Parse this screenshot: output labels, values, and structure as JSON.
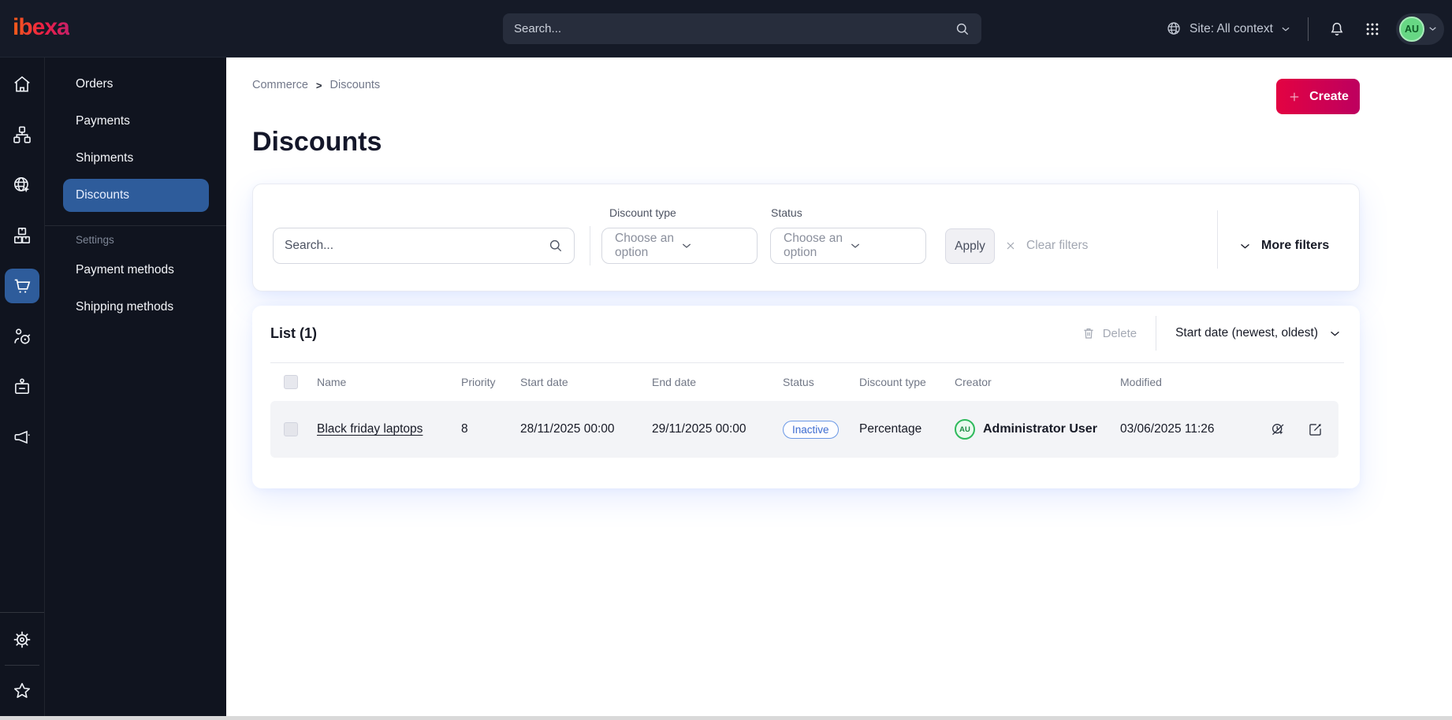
{
  "topbar": {
    "logo_text": "ibexa",
    "search_placeholder": "Search...",
    "site_context_label": "Site: All context",
    "user_initials": "AU"
  },
  "sidebar": {
    "rail_icons": [
      "home",
      "site-structure",
      "site-context",
      "products",
      "commerce",
      "audience",
      "user-badge",
      "campaigns",
      "settings",
      "bookmarks"
    ],
    "menu_items": [
      {
        "label": "Orders"
      },
      {
        "label": "Payments"
      },
      {
        "label": "Shipments"
      },
      {
        "label": "Discounts",
        "active": true
      }
    ],
    "settings_section_label": "Settings",
    "settings_items": [
      {
        "label": "Payment methods"
      },
      {
        "label": "Shipping methods"
      }
    ]
  },
  "page": {
    "breadcrumb": {
      "items": [
        "Commerce",
        "Discounts"
      ],
      "separator": ">"
    },
    "title": "Discounts",
    "create_button_label": "Create"
  },
  "filters": {
    "search_placeholder": "Search...",
    "discount_type": {
      "label": "Discount type",
      "value": "Choose an option"
    },
    "status": {
      "label": "Status",
      "value": "Choose an option"
    },
    "apply_label": "Apply",
    "clear_filters_label": "Clear filters",
    "more_filters_label": "More filters"
  },
  "list": {
    "title": "List (1)",
    "delete_label": "Delete",
    "sort_label": "Start date (newest, oldest)",
    "columns": [
      "Name",
      "Priority",
      "Start date",
      "End date",
      "Status",
      "Discount type",
      "Creator",
      "Modified"
    ],
    "rows": [
      {
        "name": "Black friday laptops",
        "priority": "8",
        "start_date": "28/11/2025 00:00",
        "end_date": "29/11/2025 00:00",
        "status": "Inactive",
        "discount_type": "Percentage",
        "creator_initials": "AU",
        "creator_name": "Administrator User",
        "modified": "03/06/2025 11:26"
      }
    ]
  },
  "colors": {
    "topbar_bg": "#151a27",
    "sidebar_bg": "#10141f",
    "active_item_blue": "#2e5c9b",
    "create_gradient_start": "#e30342",
    "create_gradient_end": "#bd005f",
    "status_inactive_text": "#3d6cd0",
    "status_inactive_border": "#6b98e6",
    "avatar_green": "#2fba5c",
    "muted_text": "#72788a",
    "dark_text": "#171a26"
  }
}
